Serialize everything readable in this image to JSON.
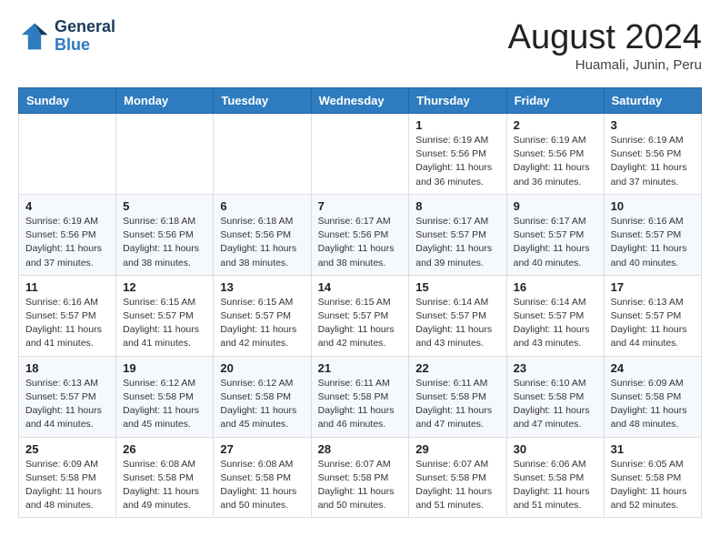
{
  "header": {
    "logo_line1": "General",
    "logo_line2": "Blue",
    "month": "August 2024",
    "location": "Huamali, Junin, Peru"
  },
  "weekdays": [
    "Sunday",
    "Monday",
    "Tuesday",
    "Wednesday",
    "Thursday",
    "Friday",
    "Saturday"
  ],
  "weeks": [
    [
      {
        "day": "",
        "info": ""
      },
      {
        "day": "",
        "info": ""
      },
      {
        "day": "",
        "info": ""
      },
      {
        "day": "",
        "info": ""
      },
      {
        "day": "1",
        "info": "Sunrise: 6:19 AM\nSunset: 5:56 PM\nDaylight: 11 hours and 36 minutes."
      },
      {
        "day": "2",
        "info": "Sunrise: 6:19 AM\nSunset: 5:56 PM\nDaylight: 11 hours and 36 minutes."
      },
      {
        "day": "3",
        "info": "Sunrise: 6:19 AM\nSunset: 5:56 PM\nDaylight: 11 hours and 37 minutes."
      }
    ],
    [
      {
        "day": "4",
        "info": "Sunrise: 6:19 AM\nSunset: 5:56 PM\nDaylight: 11 hours and 37 minutes."
      },
      {
        "day": "5",
        "info": "Sunrise: 6:18 AM\nSunset: 5:56 PM\nDaylight: 11 hours and 38 minutes."
      },
      {
        "day": "6",
        "info": "Sunrise: 6:18 AM\nSunset: 5:56 PM\nDaylight: 11 hours and 38 minutes."
      },
      {
        "day": "7",
        "info": "Sunrise: 6:17 AM\nSunset: 5:56 PM\nDaylight: 11 hours and 38 minutes."
      },
      {
        "day": "8",
        "info": "Sunrise: 6:17 AM\nSunset: 5:57 PM\nDaylight: 11 hours and 39 minutes."
      },
      {
        "day": "9",
        "info": "Sunrise: 6:17 AM\nSunset: 5:57 PM\nDaylight: 11 hours and 40 minutes."
      },
      {
        "day": "10",
        "info": "Sunrise: 6:16 AM\nSunset: 5:57 PM\nDaylight: 11 hours and 40 minutes."
      }
    ],
    [
      {
        "day": "11",
        "info": "Sunrise: 6:16 AM\nSunset: 5:57 PM\nDaylight: 11 hours and 41 minutes."
      },
      {
        "day": "12",
        "info": "Sunrise: 6:15 AM\nSunset: 5:57 PM\nDaylight: 11 hours and 41 minutes."
      },
      {
        "day": "13",
        "info": "Sunrise: 6:15 AM\nSunset: 5:57 PM\nDaylight: 11 hours and 42 minutes."
      },
      {
        "day": "14",
        "info": "Sunrise: 6:15 AM\nSunset: 5:57 PM\nDaylight: 11 hours and 42 minutes."
      },
      {
        "day": "15",
        "info": "Sunrise: 6:14 AM\nSunset: 5:57 PM\nDaylight: 11 hours and 43 minutes."
      },
      {
        "day": "16",
        "info": "Sunrise: 6:14 AM\nSunset: 5:57 PM\nDaylight: 11 hours and 43 minutes."
      },
      {
        "day": "17",
        "info": "Sunrise: 6:13 AM\nSunset: 5:57 PM\nDaylight: 11 hours and 44 minutes."
      }
    ],
    [
      {
        "day": "18",
        "info": "Sunrise: 6:13 AM\nSunset: 5:57 PM\nDaylight: 11 hours and 44 minutes."
      },
      {
        "day": "19",
        "info": "Sunrise: 6:12 AM\nSunset: 5:58 PM\nDaylight: 11 hours and 45 minutes."
      },
      {
        "day": "20",
        "info": "Sunrise: 6:12 AM\nSunset: 5:58 PM\nDaylight: 11 hours and 45 minutes."
      },
      {
        "day": "21",
        "info": "Sunrise: 6:11 AM\nSunset: 5:58 PM\nDaylight: 11 hours and 46 minutes."
      },
      {
        "day": "22",
        "info": "Sunrise: 6:11 AM\nSunset: 5:58 PM\nDaylight: 11 hours and 47 minutes."
      },
      {
        "day": "23",
        "info": "Sunrise: 6:10 AM\nSunset: 5:58 PM\nDaylight: 11 hours and 47 minutes."
      },
      {
        "day": "24",
        "info": "Sunrise: 6:09 AM\nSunset: 5:58 PM\nDaylight: 11 hours and 48 minutes."
      }
    ],
    [
      {
        "day": "25",
        "info": "Sunrise: 6:09 AM\nSunset: 5:58 PM\nDaylight: 11 hours and 48 minutes."
      },
      {
        "day": "26",
        "info": "Sunrise: 6:08 AM\nSunset: 5:58 PM\nDaylight: 11 hours and 49 minutes."
      },
      {
        "day": "27",
        "info": "Sunrise: 6:08 AM\nSunset: 5:58 PM\nDaylight: 11 hours and 50 minutes."
      },
      {
        "day": "28",
        "info": "Sunrise: 6:07 AM\nSunset: 5:58 PM\nDaylight: 11 hours and 50 minutes."
      },
      {
        "day": "29",
        "info": "Sunrise: 6:07 AM\nSunset: 5:58 PM\nDaylight: 11 hours and 51 minutes."
      },
      {
        "day": "30",
        "info": "Sunrise: 6:06 AM\nSunset: 5:58 PM\nDaylight: 11 hours and 51 minutes."
      },
      {
        "day": "31",
        "info": "Sunrise: 6:05 AM\nSunset: 5:58 PM\nDaylight: 11 hours and 52 minutes."
      }
    ]
  ]
}
